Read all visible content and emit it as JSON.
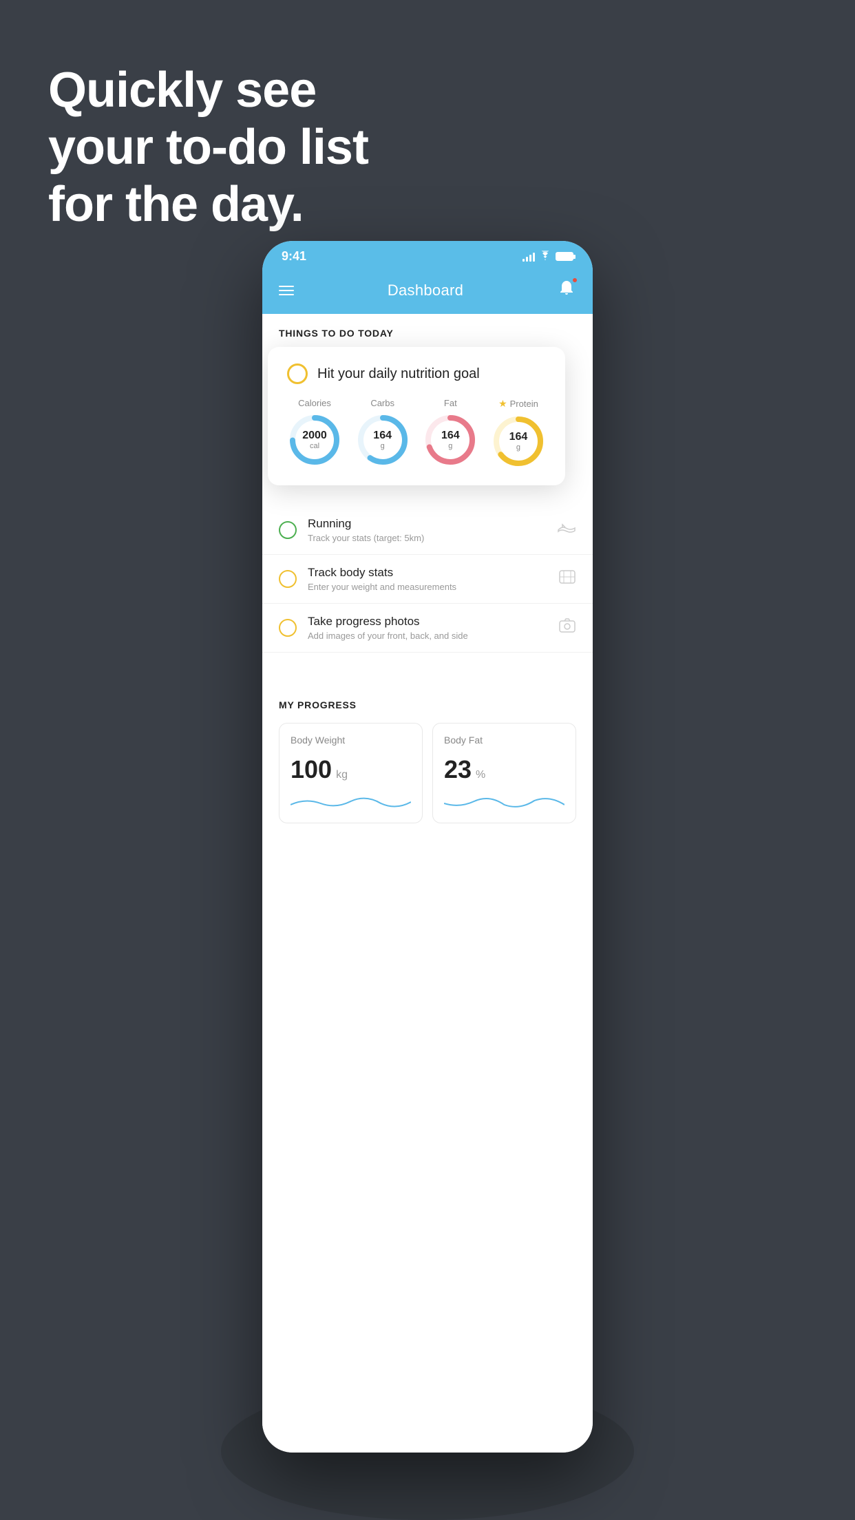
{
  "hero": {
    "line1": "Quickly see",
    "line2": "your to-do list",
    "line3": "for the day."
  },
  "phone": {
    "statusBar": {
      "time": "9:41"
    },
    "header": {
      "title": "Dashboard"
    },
    "thingsToDo": {
      "sectionLabel": "THINGS TO DO TODAY",
      "floatingCard": {
        "title": "Hit your daily nutrition goal",
        "nutrients": [
          {
            "label": "Calories",
            "value": "2000",
            "unit": "cal",
            "color": "#5ab8e8",
            "starred": false
          },
          {
            "label": "Carbs",
            "value": "164",
            "unit": "g",
            "color": "#5ab8e8",
            "starred": false
          },
          {
            "label": "Fat",
            "value": "164",
            "unit": "g",
            "color": "#e87a8a",
            "starred": false
          },
          {
            "label": "Protein",
            "value": "164",
            "unit": "g",
            "color": "#f0c030",
            "starred": true
          }
        ]
      },
      "tasks": [
        {
          "name": "Running",
          "sub": "Track your stats (target: 5km)",
          "circleColor": "green",
          "icon": "shoe"
        },
        {
          "name": "Track body stats",
          "sub": "Enter your weight and measurements",
          "circleColor": "yellow",
          "icon": "scale"
        },
        {
          "name": "Take progress photos",
          "sub": "Add images of your front, back, and side",
          "circleColor": "yellow",
          "icon": "photo"
        }
      ]
    },
    "progress": {
      "title": "MY PROGRESS",
      "cards": [
        {
          "title": "Body Weight",
          "value": "100",
          "unit": "kg"
        },
        {
          "title": "Body Fat",
          "value": "23",
          "unit": "%"
        }
      ]
    }
  }
}
